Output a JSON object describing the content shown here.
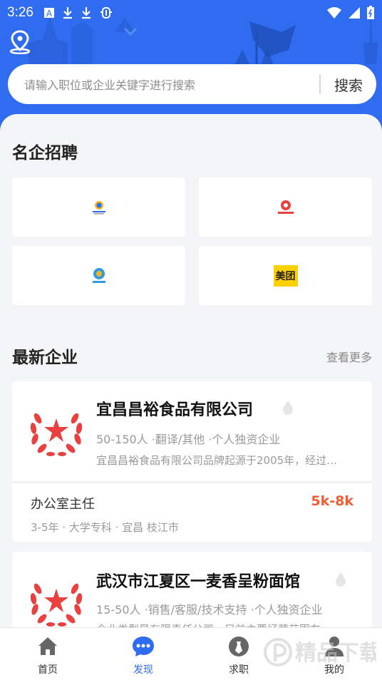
{
  "status_bar": {
    "time": "3:26"
  },
  "search": {
    "placeholder": "请输入职位或企业关键字进行搜索",
    "button_label": "搜索"
  },
  "famous": {
    "title": "名企招聘",
    "logos": [
      {
        "name": "company-logo-1"
      },
      {
        "name": "company-logo-2"
      },
      {
        "name": "company-logo-3"
      },
      {
        "name": "meituan",
        "text": "美团"
      }
    ]
  },
  "latest": {
    "title": "最新企业",
    "more_label": "查看更多",
    "companies": [
      {
        "name": "宜昌昌裕食品有限公司",
        "meta": "50-150人 ·翻译/其他 ·个人独资企业",
        "desc": "宜昌昌裕食品有限公司品牌起源于2005年，经过…",
        "job": {
          "title": "办公室主任",
          "salary": "5k-8k",
          "meta": "3-5年 · 大学专科 · 宜昌 枝江市"
        }
      },
      {
        "name": "武汉市江夏区一麦香呈粉面馆",
        "meta": "15-50人 ·销售/客服/技术支持 ·个人独资企业",
        "desc": "企业类型是有限责任公司，目前主要经营范围在…"
      }
    ]
  },
  "nav": {
    "items": [
      {
        "label": "首页",
        "icon": "home-icon"
      },
      {
        "label": "发现",
        "icon": "discover-icon",
        "active": true
      },
      {
        "label": "求职",
        "icon": "job-seek-icon"
      },
      {
        "label": "我的",
        "icon": "profile-icon"
      }
    ]
  },
  "watermark": {
    "text": "精品下载"
  },
  "colors": {
    "brand": "#2f6cf0",
    "salary": "#f25c33",
    "badge_red": "#e94040"
  }
}
